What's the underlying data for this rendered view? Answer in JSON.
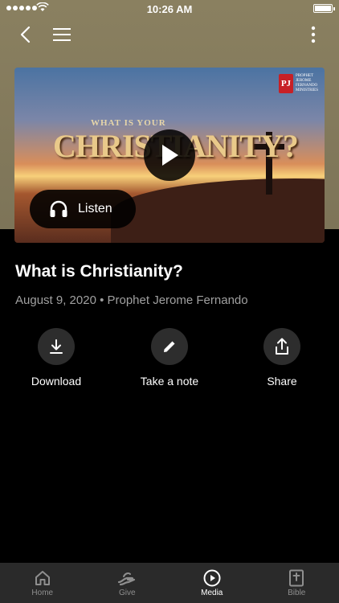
{
  "status_bar": {
    "time": "10:26 AM"
  },
  "media": {
    "subtitle": "WHAT IS YOUR",
    "title": "CHRISTIANITY?",
    "logo_mark": "PJ",
    "logo_lines": [
      "PROPHET",
      "JEROME",
      "FERNANDO",
      "MINISTRIES"
    ],
    "listen_label": "Listen"
  },
  "sermon": {
    "title": "What is Christianity?",
    "meta": "August 9, 2020 • Prophet Jerome Fernando"
  },
  "actions": [
    {
      "label": "Download",
      "icon": "download-icon"
    },
    {
      "label": "Take a note",
      "icon": "pencil-icon"
    },
    {
      "label": "Share",
      "icon": "share-icon"
    }
  ],
  "tabs": [
    {
      "label": "Home",
      "icon": "home-icon",
      "active": false
    },
    {
      "label": "Give",
      "icon": "give-icon",
      "active": false
    },
    {
      "label": "Media",
      "icon": "play-circle-icon",
      "active": true
    },
    {
      "label": "Bible",
      "icon": "bible-icon",
      "active": false
    }
  ]
}
